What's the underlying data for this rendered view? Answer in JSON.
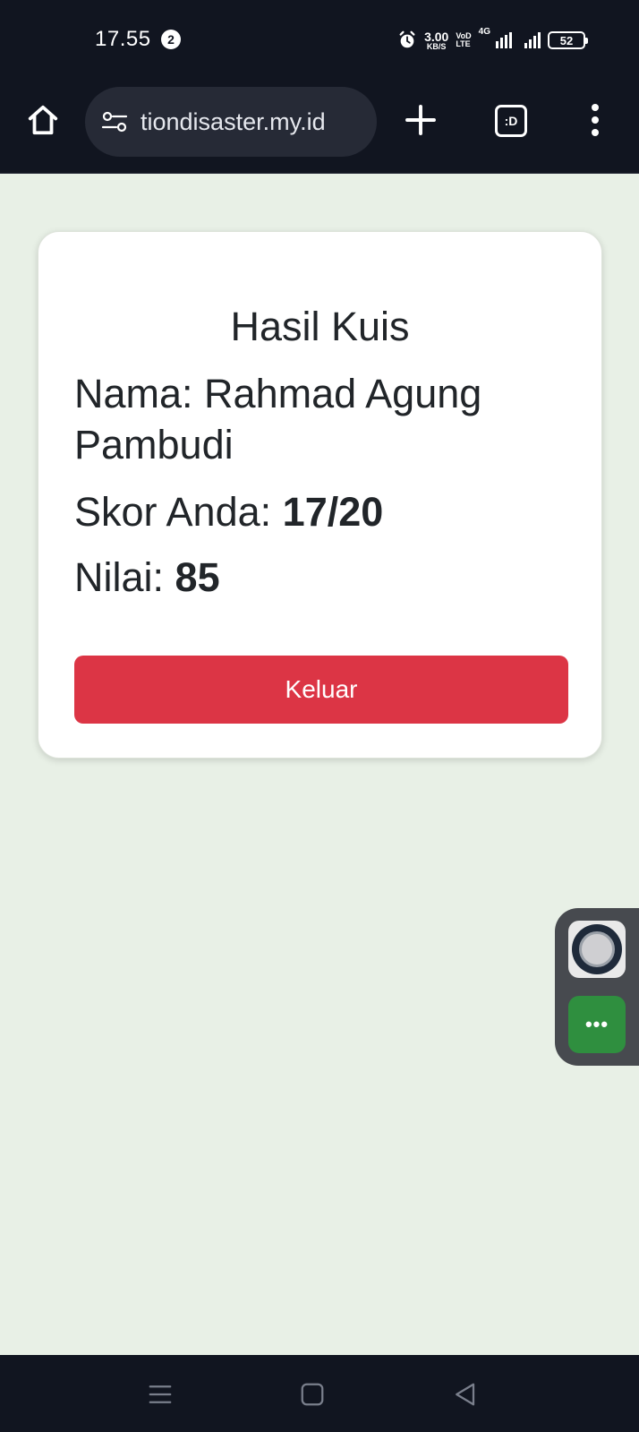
{
  "status_bar": {
    "time": "17.55",
    "notification_count": "2",
    "net_speed_value": "3.00",
    "net_speed_unit": "KB/S",
    "volte_top": "VoD",
    "volte_bottom": "LTE",
    "network_type": "4G",
    "battery_level": "52",
    "icons": [
      "alarm-icon",
      "signal-icon",
      "battery-icon"
    ]
  },
  "browser": {
    "url": "tiondisaster.my.id",
    "tabs_label": ":D",
    "icons": [
      "home-icon",
      "site-settings-icon",
      "add-tab-icon",
      "menu-icon"
    ]
  },
  "result": {
    "title": "Hasil Kuis",
    "name_line": "Nama: Rahmad Agung Pambudi",
    "score_label": "Skor Anda:",
    "score_value": "17/20",
    "grade_label": "Nilai:",
    "grade_value": "85",
    "logout_label": "Keluar",
    "logout_color": "#dc3545"
  },
  "float_widget": {
    "more_label": "•••",
    "more_color": "#2f8f3f"
  },
  "nav_bar": {
    "icons": [
      "recents-icon",
      "home-icon",
      "back-icon"
    ]
  },
  "theme": {
    "page_background": "#e8f0e6",
    "system_bar_color": "#111520",
    "card_background": "#ffffff",
    "text_color": "#212529"
  }
}
